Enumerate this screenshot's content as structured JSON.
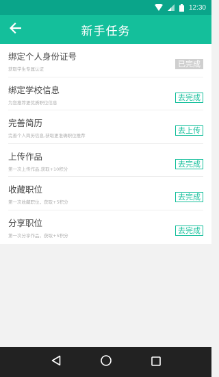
{
  "status_bar": {
    "time": "12:30"
  },
  "header": {
    "title": "新手任务",
    "back_icon": "arrow-left-icon"
  },
  "tasks": [
    {
      "name": "绑定个人身份证号",
      "desc": "获取学生专属认证",
      "action": "已完成",
      "done": true
    },
    {
      "name": "绑定学校信息",
      "desc": "为您推荐更优质职位信息",
      "action": "去完成",
      "done": false
    },
    {
      "name": "完善简历",
      "desc": "完善个人简历信息,获取更准确职位推荐",
      "action": "去上传",
      "done": false
    },
    {
      "name": "上传作品",
      "desc": "第一次上传作品,获取+10积分",
      "action": "去完成",
      "done": false
    },
    {
      "name": "收藏职位",
      "desc": "第一次收藏职位，获取+5积分",
      "action": "去完成",
      "done": false
    },
    {
      "name": "分享职位",
      "desc": "第一次分享作品，获取+5积分",
      "action": "去完成",
      "done": false
    }
  ],
  "colors": {
    "accent": "#14bf9b",
    "status_bar": "#0aa58a",
    "done": "#cfcfcf",
    "nav_bar": "#222222"
  }
}
